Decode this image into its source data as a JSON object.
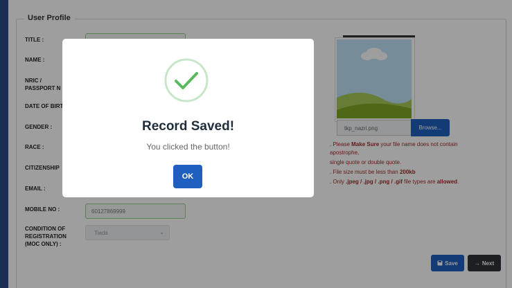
{
  "form": {
    "legend": "User Profile",
    "labels": {
      "title": "TITLE :",
      "name": "NAME :",
      "nric_1": "NRIC /",
      "nric_2": "PASSPORT N",
      "dob": "DATE OF BIRT",
      "gender": "GENDER :",
      "race": "RACE :",
      "citizenship": "CITIZENSHIP",
      "email": "EMAIL :",
      "mobile": "MOBILE NO :",
      "moc_1": "CONDITION OF",
      "moc_2": "REGISTRATION",
      "moc_3": "(MOC ONLY) :"
    },
    "mobile_value": "60127869999",
    "moc_value": "Tiada"
  },
  "photo": {
    "file_name": "tkp_nazri.png",
    "browse_label": "Browse...",
    "notes": {
      "line1_pre": ". Please ",
      "line1_bold": "Make Sure",
      "line1_post": " your file name does not contain",
      "line2": "apostrophe,",
      "line3": "single quote or double quote.",
      "line4_pre": ". File size must be less than ",
      "line4_bold": "200kb",
      "line5_pre": ". Only ",
      "line5_bold": ".jpeg / .jpg / .png / .gif",
      "line5_mid": " file types are ",
      "line5_bold2": "allowed",
      "line5_post": "."
    }
  },
  "buttons": {
    "save": "Save",
    "next": "Next"
  },
  "modal": {
    "title": "Record Saved!",
    "text": "You clicked the button!",
    "ok": "OK"
  },
  "colors": {
    "primary": "#1f5fbf",
    "success": "#5cb85c",
    "brand_bg": "#2b4a86"
  },
  "icons": {
    "success": "check-circle-icon",
    "save": "save-icon",
    "next": "arrow-right-icon",
    "photo": "landscape-placeholder-icon"
  }
}
